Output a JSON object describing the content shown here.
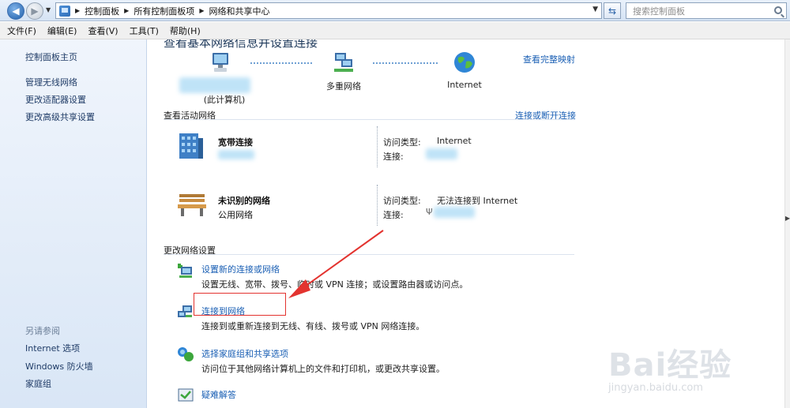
{
  "address": {
    "crumbs": [
      "控制面板",
      "所有控制面板项",
      "网络和共享中心"
    ],
    "search_placeholder": "搜索控制面板"
  },
  "menu": [
    "文件(F)",
    "编辑(E)",
    "查看(V)",
    "工具(T)",
    "帮助(H)"
  ],
  "sidebar": {
    "home": "控制面板主页",
    "links": [
      "管理无线网络",
      "更改适配器设置",
      "更改高级共享设置"
    ],
    "see_also_title": "另请参阅",
    "see_also": [
      "Internet 选项",
      "Windows 防火墙",
      "家庭组"
    ]
  },
  "main": {
    "heading": "查看基本网络信息并设置连接",
    "map_link": "查看完整映射",
    "map_nodes": {
      "computer": "(此计算机)",
      "multi": "多重网络",
      "internet": "Internet"
    },
    "active_title": "查看活动网络",
    "connect_link": "连接或断开连接",
    "networks": [
      {
        "name": "宽带连接",
        "type": "",
        "access_label": "访问类型:",
        "access_value": "Internet",
        "conn_label": "连接:"
      },
      {
        "name": "未识别的网络",
        "type": "公用网络",
        "access_label": "访问类型:",
        "access_value": "无法连接到 Internet",
        "conn_label": "连接:"
      }
    ],
    "change_title": "更改网络设置",
    "tasks": [
      {
        "link": "设置新的连接或网络",
        "desc": "设置无线、宽带、拨号、临时或 VPN 连接；或设置路由器或访问点。"
      },
      {
        "link": "连接到网络",
        "desc": "连接到或重新连接到无线、有线、拨号或 VPN 网络连接。"
      },
      {
        "link": "选择家庭组和共享选项",
        "desc": "访问位于其他网络计算机上的文件和打印机，或更改共享设置。"
      },
      {
        "link": "疑难解答",
        "desc": ""
      }
    ]
  },
  "watermark": {
    "big": "Bai经验",
    "small": "jingyan.baidu.com"
  },
  "colors": {
    "link": "#1a5fb4",
    "highlight_box": "#e3332f",
    "arrow": "#e3332f"
  }
}
